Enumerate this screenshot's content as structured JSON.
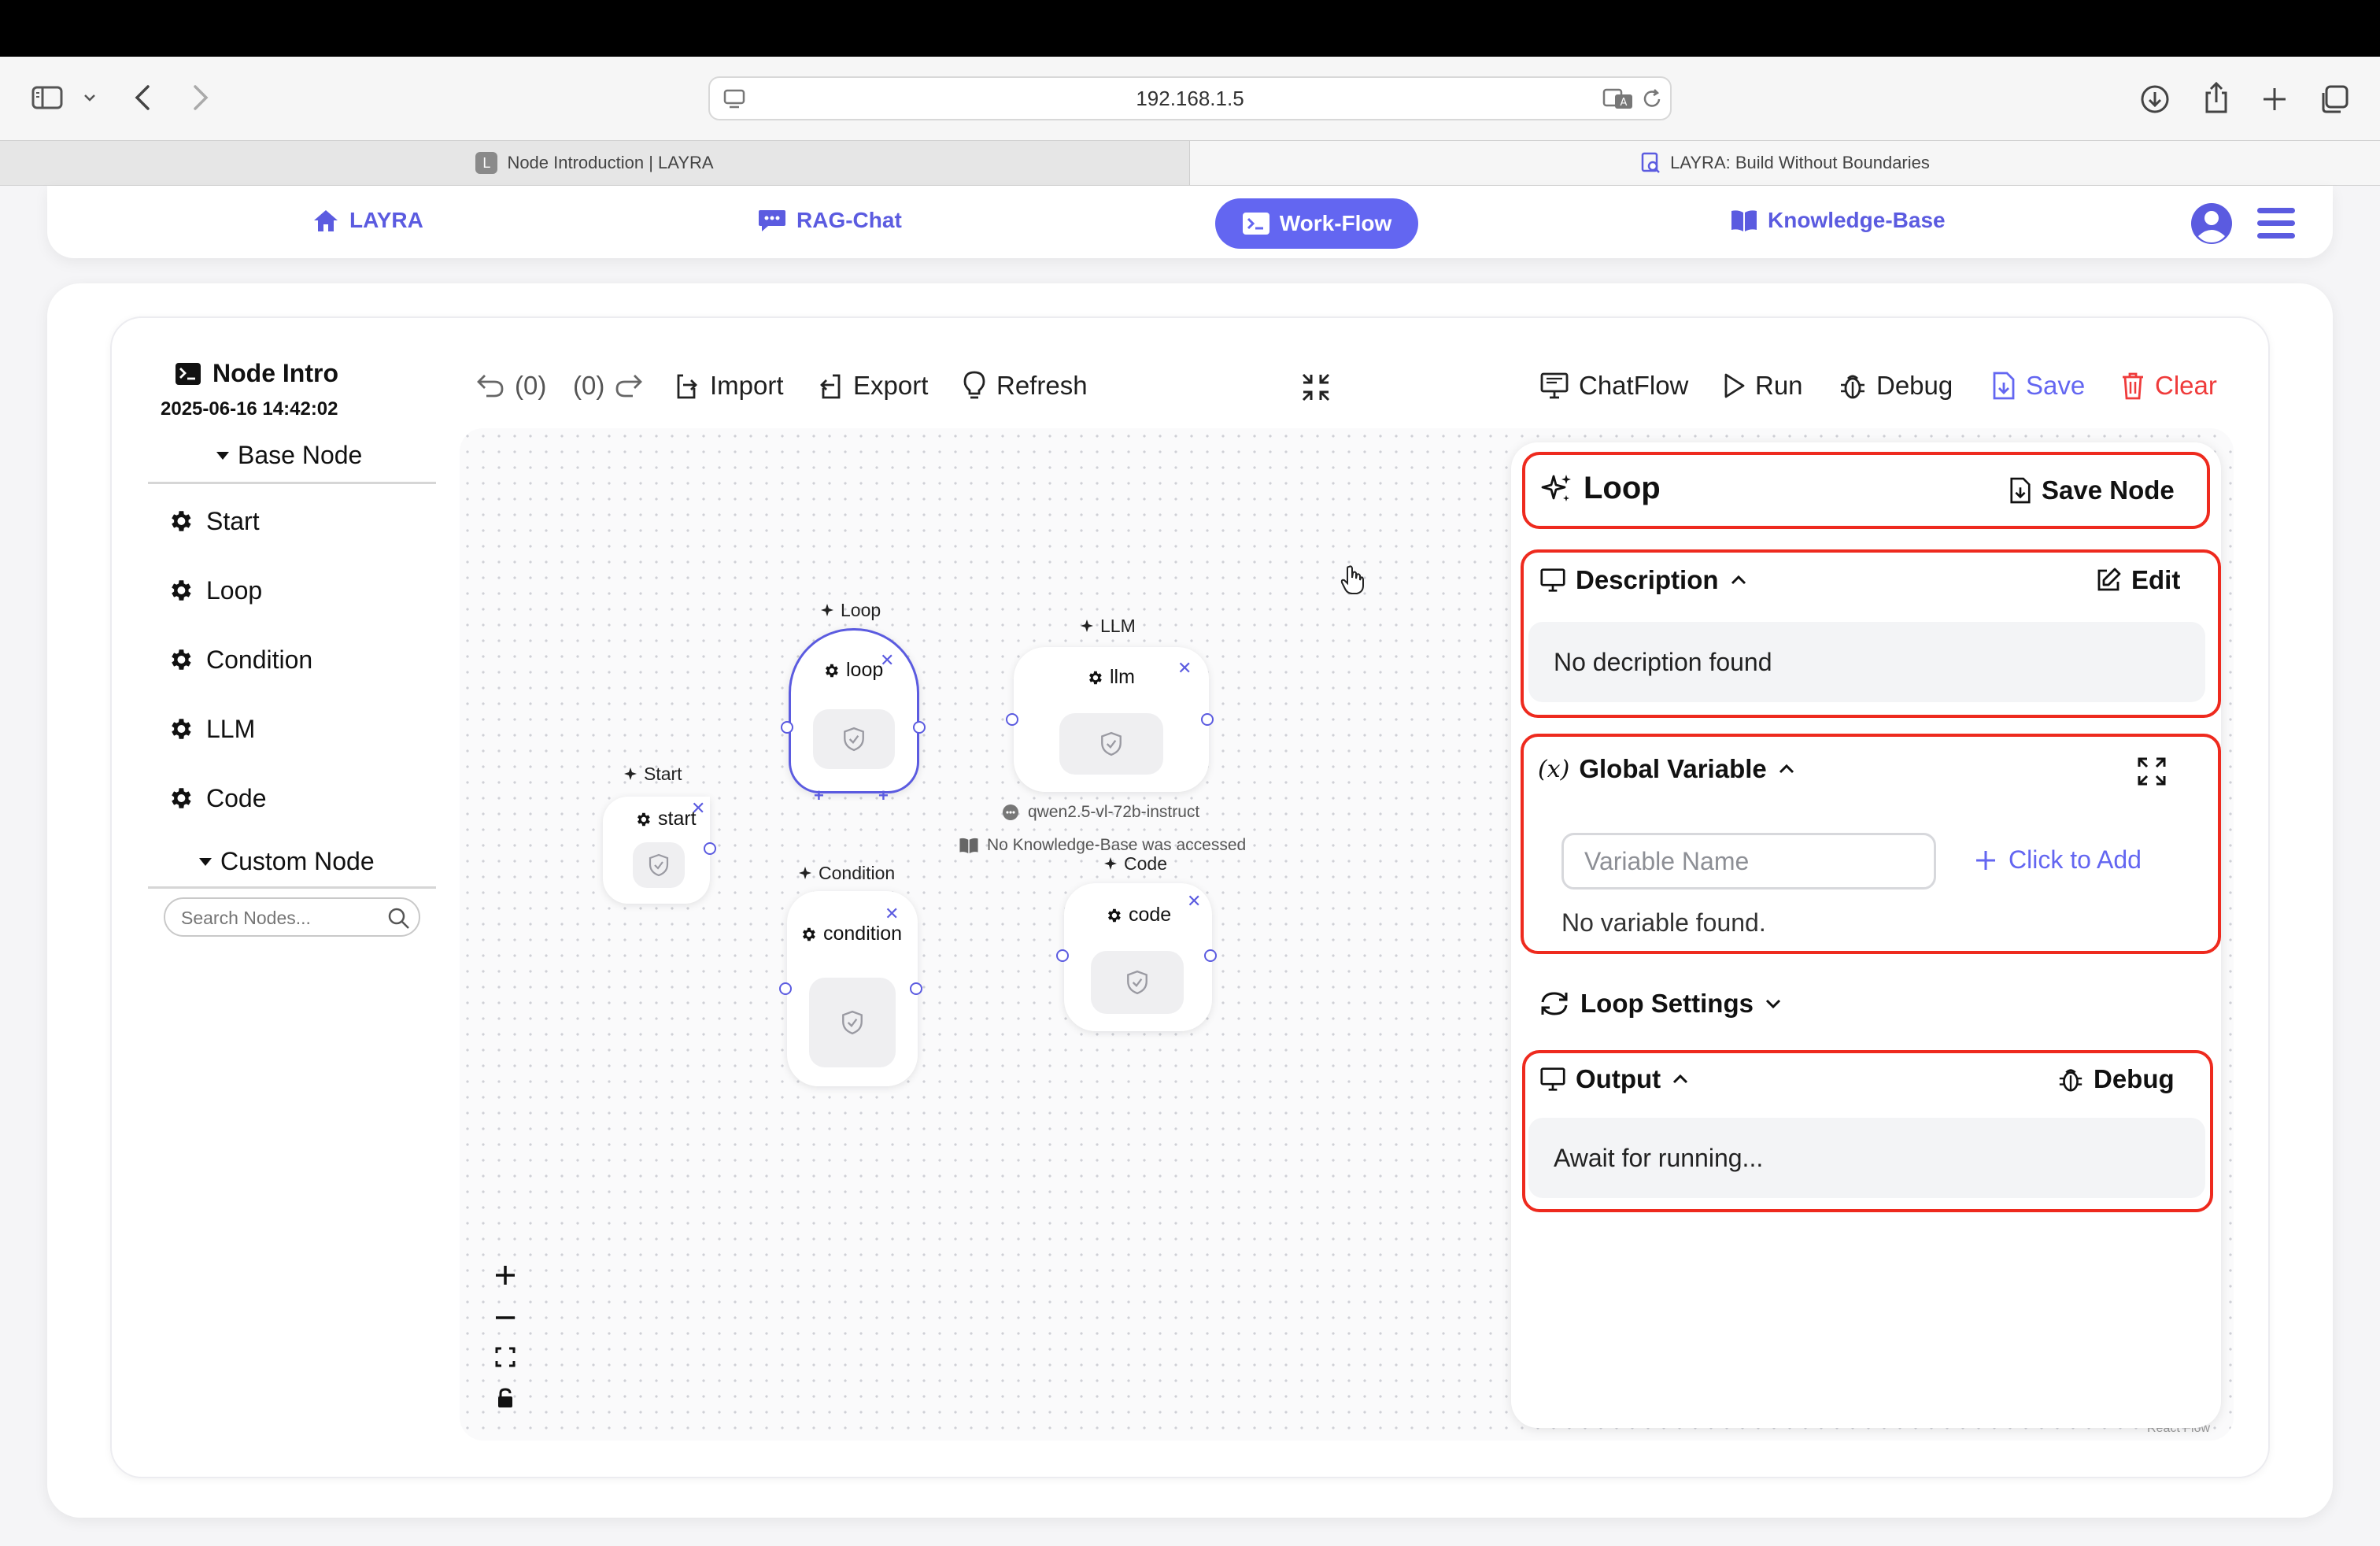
{
  "browser": {
    "url": "192.168.1.5",
    "tabs": [
      {
        "label": "Node Introduction | LAYRA",
        "favicon": "L"
      },
      {
        "label": "LAYRA: Build Without Boundaries"
      }
    ]
  },
  "app_nav": {
    "brand": "LAYRA",
    "items": [
      "RAG-Chat",
      "Work-Flow",
      "Knowledge-Base"
    ],
    "active": "Work-Flow",
    "accent": "#6366f1"
  },
  "workflow": {
    "name": "Node Intro",
    "timestamp": "2025-06-16 14:42:02",
    "base_section": "Base Node",
    "base_nodes": [
      "Start",
      "Loop",
      "Condition",
      "LLM",
      "Code"
    ],
    "custom_section": "Custom Node",
    "search_placeholder": "Search Nodes..."
  },
  "toolbar": {
    "undo_count": "(0)",
    "redo_count": "(0)",
    "import": "Import",
    "export": "Export",
    "refresh": "Refresh",
    "chatflow": "ChatFlow",
    "run": "Run",
    "debug": "Debug",
    "save": "Save",
    "clear": "Clear"
  },
  "canvas": {
    "nodes": {
      "start": {
        "title": "Start",
        "label": "start"
      },
      "loop": {
        "title": "Loop",
        "label": "loop"
      },
      "llm": {
        "title": "LLM",
        "label": "llm",
        "model": "qwen2.5-vl-72b-instruct",
        "kb_note": "No Knowledge-Base was accessed"
      },
      "condition": {
        "title": "Condition",
        "label": "condition"
      },
      "code": {
        "title": "Code",
        "label": "code"
      }
    },
    "attribution": "React Flow"
  },
  "panel": {
    "node_name": "Loop",
    "save_node": "Save Node",
    "description": {
      "title": "Description",
      "edit": "Edit",
      "text": "No decription found"
    },
    "global_variable": {
      "title": "Global Variable",
      "placeholder": "Variable Name",
      "add": "Click to Add",
      "empty": "No variable found."
    },
    "loop_settings": {
      "title": "Loop Settings"
    },
    "output": {
      "title": "Output",
      "debug": "Debug",
      "text": "Await for running..."
    }
  }
}
